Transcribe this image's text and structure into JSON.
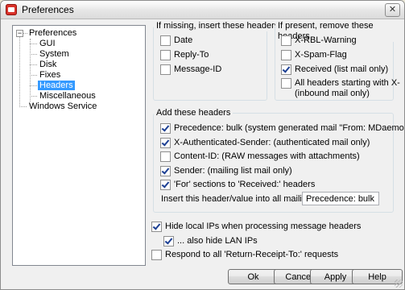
{
  "window": {
    "title": "Preferences",
    "close_label": "✕"
  },
  "tree": {
    "root": "Preferences",
    "expander": "−",
    "children": [
      "GUI",
      "System",
      "Disk",
      "Fixes",
      "Headers",
      "Miscellaneous"
    ],
    "selected": "Headers",
    "sibling": "Windows Service"
  },
  "missing_group": {
    "title": "If missing, insert these headers",
    "items": [
      {
        "label": "Date",
        "checked": false
      },
      {
        "label": "Reply-To",
        "checked": false
      },
      {
        "label": "Message-ID",
        "checked": false
      }
    ]
  },
  "present_group": {
    "title": "If present, remove these headers",
    "items": [
      {
        "label": "X-RBL-Warning",
        "checked": false
      },
      {
        "label": "X-Spam-Flag",
        "checked": false
      },
      {
        "label": "Received (list mail only)",
        "checked": true
      },
      {
        "label": "All headers starting with X-",
        "label2": "(inbound mail only)",
        "checked": false
      }
    ]
  },
  "add_group": {
    "title": "Add these headers",
    "items": [
      {
        "label": "Precedence: bulk (system generated mail \"From: MDaemon\" only)",
        "checked": true
      },
      {
        "label": "X-Authenticated-Sender: (authenticated mail only)",
        "checked": true
      },
      {
        "label": "Content-ID: (RAW messages with attachments)",
        "checked": false
      },
      {
        "label": "Sender: (mailing list mail only)",
        "checked": true
      },
      {
        "label": "'For' sections to 'Received:' headers",
        "checked": true
      }
    ],
    "insert_label": "Insert this header/value into all mailing list mail",
    "insert_value": "Precedence: bulk"
  },
  "options": [
    {
      "label": "Hide local IPs when processing message headers",
      "checked": true
    },
    {
      "label": "... also hide LAN IPs",
      "checked": true
    },
    {
      "label": "Respond to all 'Return-Receipt-To:' requests",
      "checked": false
    }
  ],
  "buttons": {
    "ok": "Ok",
    "cancel": "Cancel",
    "apply": "Apply",
    "help": "Help"
  }
}
